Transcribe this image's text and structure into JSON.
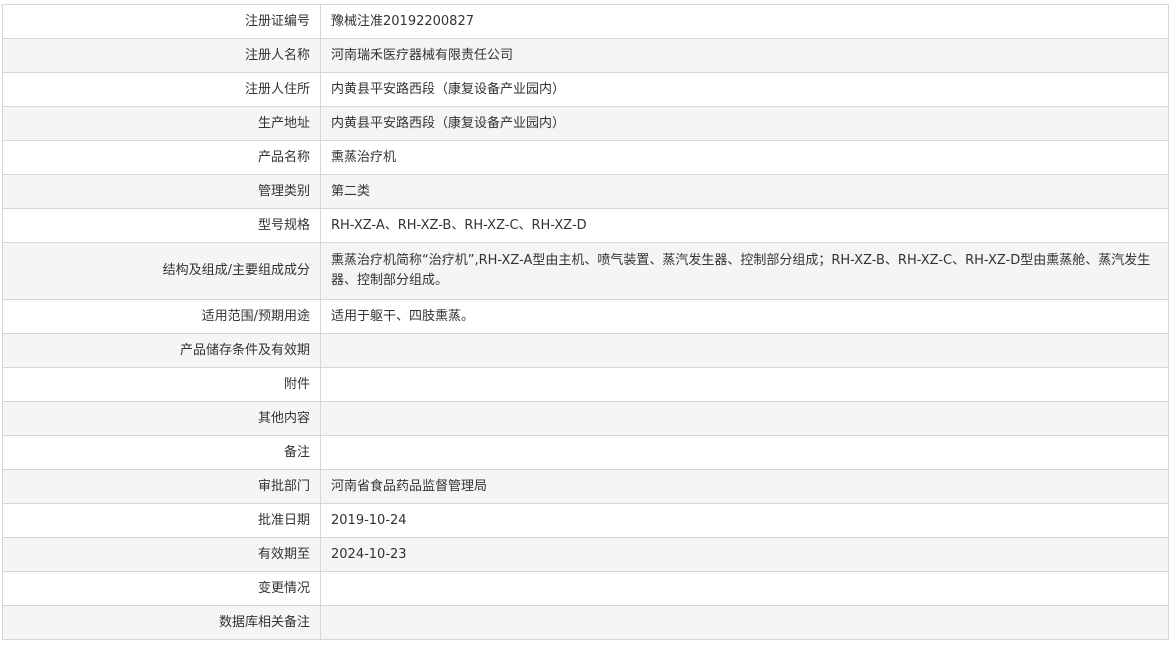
{
  "rows": [
    {
      "label": "注册证编号",
      "value": "豫械注准20192200827"
    },
    {
      "label": "注册人名称",
      "value": "河南瑞禾医疗器械有限责任公司"
    },
    {
      "label": "注册人住所",
      "value": "内黄县平安路西段（康复设备产业园内）"
    },
    {
      "label": "生产地址",
      "value": "内黄县平安路西段（康复设备产业园内）"
    },
    {
      "label": "产品名称",
      "value": "熏蒸治疗机"
    },
    {
      "label": "管理类别",
      "value": "第二类"
    },
    {
      "label": "型号规格",
      "value": "RH-XZ-A、RH-XZ-B、RH-XZ-C、RH-XZ-D"
    },
    {
      "label": "结构及组成/主要组成成分",
      "value": "熏蒸治疗机简称“治疗机”,RH-XZ-A型由主机、喷气装置、蒸汽发生器、控制部分组成；RH-XZ-B、RH-XZ-C、RH-XZ-D型由熏蒸舱、蒸汽发生器、控制部分组成。"
    },
    {
      "label": "适用范围/预期用途",
      "value": "适用于躯干、四肢熏蒸。"
    },
    {
      "label": "产品储存条件及有效期",
      "value": ""
    },
    {
      "label": "附件",
      "value": ""
    },
    {
      "label": "其他内容",
      "value": ""
    },
    {
      "label": "备注",
      "value": ""
    },
    {
      "label": "审批部门",
      "value": "河南省食品药品监督管理局"
    },
    {
      "label": "批准日期",
      "value": "2019-10-24"
    },
    {
      "label": "有效期至",
      "value": "2024-10-23"
    },
    {
      "label": "变更情况",
      "value": ""
    },
    {
      "label": "数据库相关备注",
      "value": ""
    }
  ]
}
